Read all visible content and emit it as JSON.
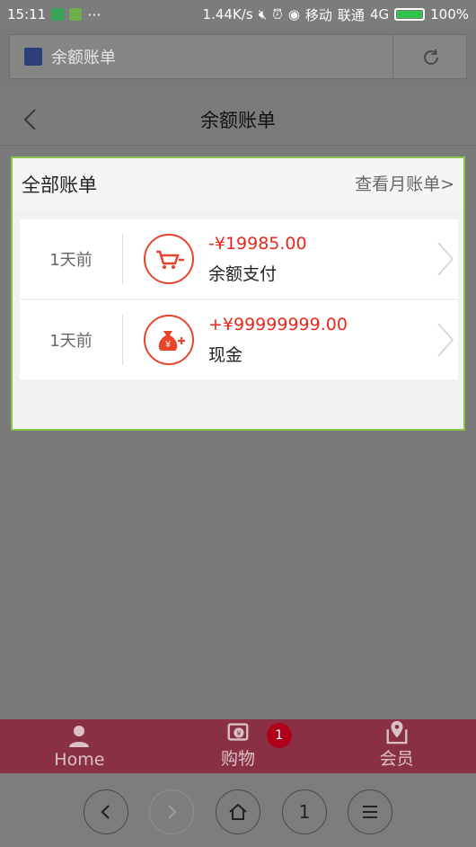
{
  "status_bar": {
    "time": "15:11",
    "speed": "1.44K/s",
    "carrier1": "移动",
    "carrier2": "联通",
    "network": "4G",
    "battery": "100%"
  },
  "address_bar": {
    "title": "余额账单",
    "refresh_icon": "refresh-icon"
  },
  "header": {
    "title": "余额账单",
    "back_icon": "chevron-left-icon"
  },
  "panel": {
    "title": "全部账单",
    "monthly_link": "查看月账单>",
    "accent_color": "#8bc34a",
    "bills": [
      {
        "time": "1天前",
        "amount": "-¥19985.00",
        "desc": "余额支付",
        "icon": "cart-minus-icon"
      },
      {
        "time": "1天前",
        "amount": "+¥99999999.00",
        "desc": "现金",
        "icon": "money-bag-plus-icon"
      }
    ]
  },
  "bottom_nav": {
    "items": [
      {
        "label": "Home",
        "icon": "person-icon"
      },
      {
        "label": "购物",
        "icon": "cart-icon",
        "badge": "1"
      },
      {
        "label": "会员",
        "icon": "map-pin-icon"
      }
    ]
  },
  "system_nav": {
    "buttons": [
      "back-icon",
      "forward-icon",
      "home-icon",
      "tabs-icon",
      "menu-icon"
    ],
    "tab_count": "1"
  }
}
